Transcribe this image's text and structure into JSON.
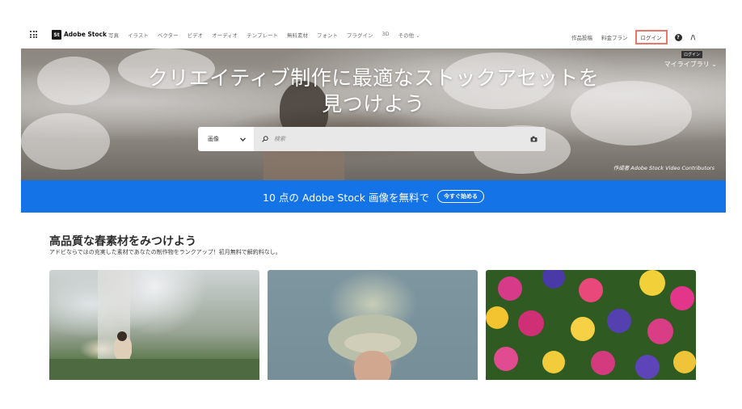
{
  "nav": {
    "logo_mark": "St",
    "brand": "Adobe Stock",
    "menu": [
      "写真",
      "イラスト",
      "ベクター",
      "ビデオ",
      "オーディオ",
      "テンプレート",
      "無料素材",
      "フォント",
      "プラグイン",
      "3D",
      "その他 ⌄"
    ],
    "contribute": "作品投稿",
    "pricing": "料金プラン",
    "login": "ログイン",
    "help": "?",
    "adobe_logo": "/\\"
  },
  "hero": {
    "title_line1": "クリエイティブ制作に最適なストックアセットを",
    "title_line2": "見つけよう",
    "my_library": "マイライブラリ ⌄",
    "login_tooltip": "ログイン",
    "search_type": "画像",
    "search_placeholder": "検索",
    "credit": "作成者 Adobe Stock Video Contributors"
  },
  "banner": {
    "text": "10 点の Adobe Stock 画像を無料で",
    "cta": "今すぐ始める"
  },
  "section": {
    "title": "高品質な春素材をみつけよう",
    "subtitle": "アドビならではの充実した素材であなたの制作物をランクアップ！初月無料で解約料なし。"
  },
  "colors": {
    "banner": "#1473e6",
    "login_highlight": "#e8776a"
  }
}
